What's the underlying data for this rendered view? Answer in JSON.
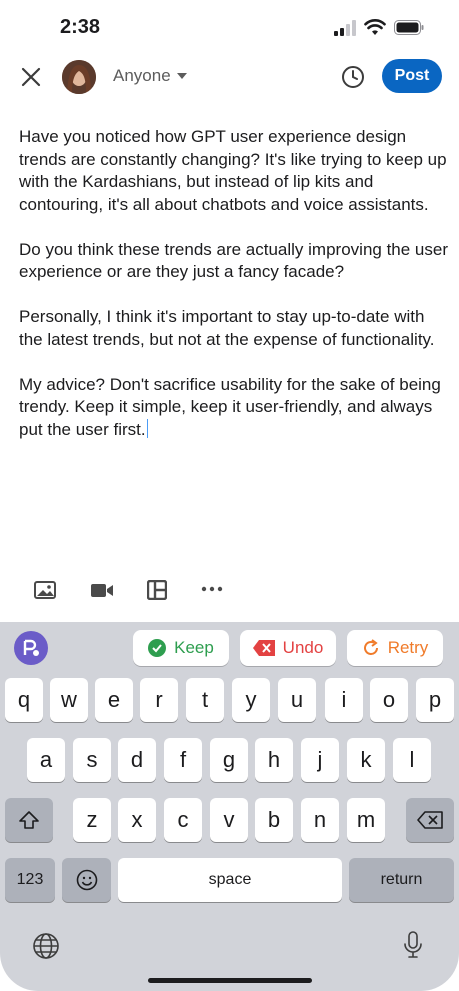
{
  "status": {
    "time": "2:38"
  },
  "topbar": {
    "audience": "Anyone",
    "post_label": "Post"
  },
  "post": {
    "paragraphs": [
      "Have you noticed how GPT user experience design trends are constantly changing? It's like trying to keep up with the Kardashians, but instead of lip kits and contouring, it's all about chatbots and voice assistants.",
      "Do you think these trends are actually improving the user experience or are they just a fancy facade?",
      "Personally, I think it's important to stay up-to-date with the latest trends, but not at the expense of functionality.",
      "My advice? Don't sacrifice usability for the sake of being trendy. Keep it simple, keep it user-friendly, and always put the user first."
    ]
  },
  "toolbar": {
    "icons": [
      "image-icon",
      "video-icon",
      "template-icon",
      "more-icon"
    ]
  },
  "ai_bar": {
    "keep": "Keep",
    "undo": "Undo",
    "retry": "Retry"
  },
  "keyboard": {
    "row1": [
      "q",
      "w",
      "e",
      "r",
      "t",
      "y",
      "u",
      "i",
      "o",
      "p"
    ],
    "row2": [
      "a",
      "s",
      "d",
      "f",
      "g",
      "h",
      "j",
      "k",
      "l"
    ],
    "row3": [
      "z",
      "x",
      "c",
      "v",
      "b",
      "n",
      "m"
    ],
    "numbers": "123",
    "space": "space",
    "return": "return"
  },
  "colors": {
    "accent": "#0a66c2",
    "keep": "#2e9e4f",
    "undo": "#e34242",
    "retry": "#f07b2a"
  }
}
